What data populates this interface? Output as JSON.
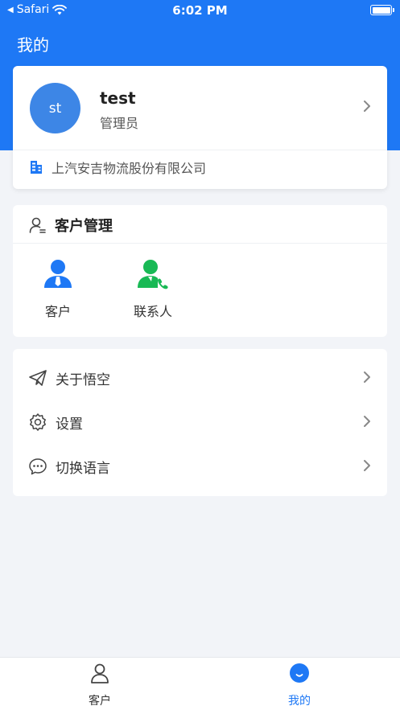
{
  "status_bar": {
    "back_app": "Safari",
    "time": "6:02 PM"
  },
  "header": {
    "title": "我的"
  },
  "profile": {
    "avatar_text": "st",
    "name": "test",
    "role": "管理员",
    "company": "上汽安吉物流股份有限公司"
  },
  "customer_management": {
    "title": "客户管理",
    "items": [
      {
        "label": "客户",
        "icon": "customer-icon",
        "color": "#1e78f5"
      },
      {
        "label": "联系人",
        "icon": "contact-phone-icon",
        "color": "#19b955"
      }
    ]
  },
  "menu": {
    "items": [
      {
        "label": "关于悟空",
        "icon": "paper-plane-icon"
      },
      {
        "label": "设置",
        "icon": "gear-icon"
      },
      {
        "label": "切换语言",
        "icon": "chat-bubble-icon"
      }
    ]
  },
  "tabbar": {
    "tabs": [
      {
        "label": "客户",
        "icon": "person-icon",
        "active": false
      },
      {
        "label": "我的",
        "icon": "smile-icon",
        "active": true
      }
    ]
  },
  "colors": {
    "primary": "#1e78f5",
    "green": "#19b955",
    "avatar": "#3d86e6",
    "background": "#f2f4f8"
  }
}
